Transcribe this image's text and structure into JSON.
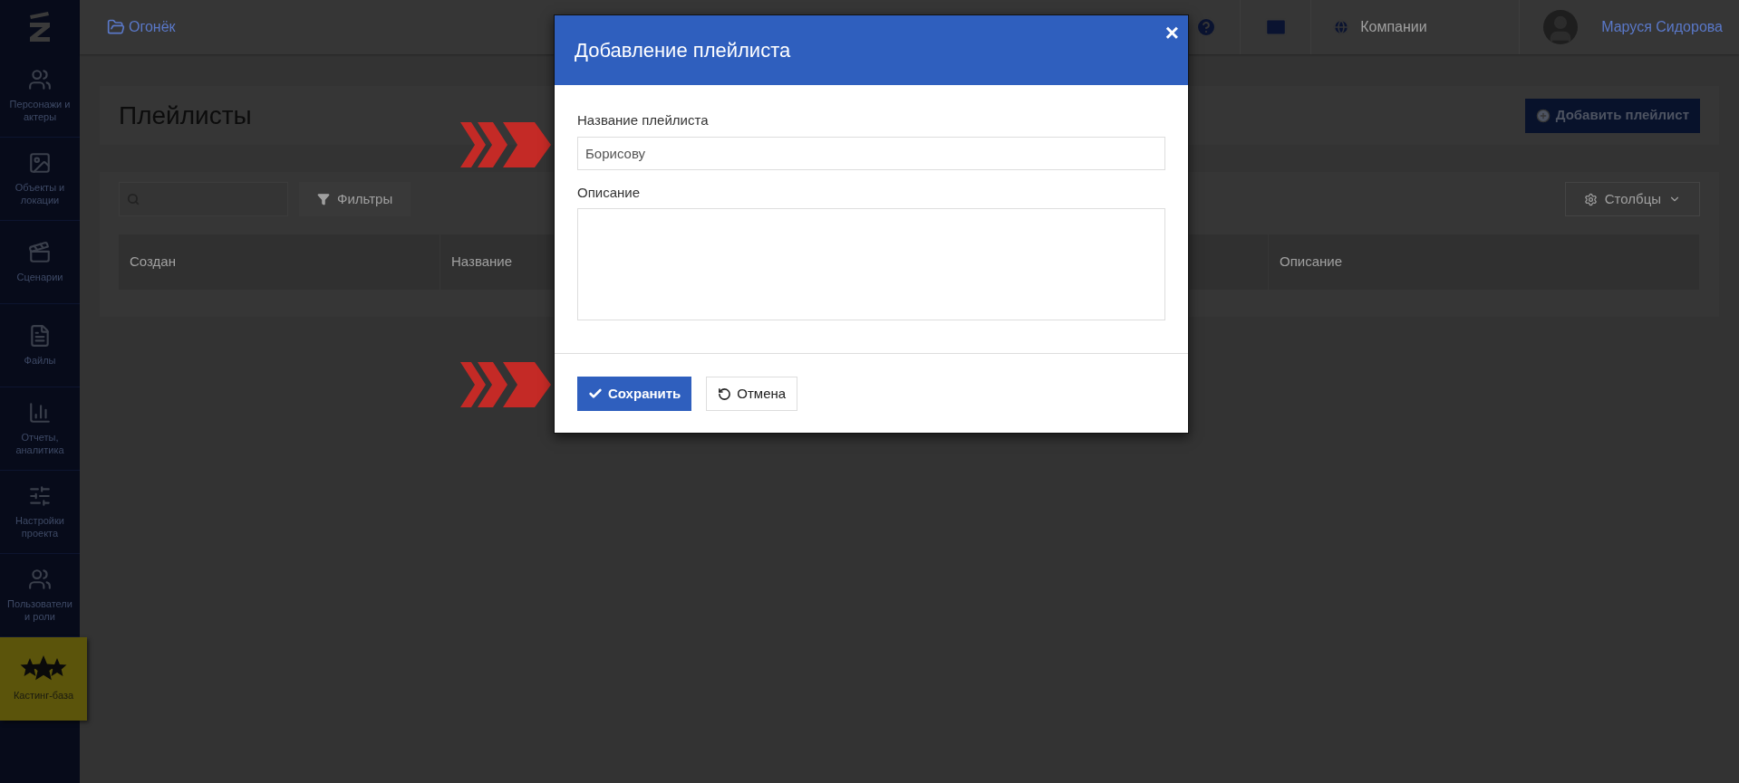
{
  "sidebar": {
    "items": [
      {
        "label": "Персонажи и актеры",
        "selected": false
      },
      {
        "label": "Объекты и локации",
        "selected": false
      },
      {
        "label": "Сценарии",
        "selected": false
      },
      {
        "label": "Файлы",
        "selected": false
      },
      {
        "label": "Отчеты, аналитика",
        "selected": false
      },
      {
        "label": "Настройки проекта",
        "selected": false
      },
      {
        "label": "Пользователи и роли",
        "selected": false
      },
      {
        "label": "Кастинг-база",
        "selected": true
      }
    ]
  },
  "topbar": {
    "breadcrumb": "Огонёк",
    "company_link": "Компании",
    "user_name": "Маруся Сидорова"
  },
  "page": {
    "title": "Плейлисты",
    "add_button": "Добавить плейлист",
    "filters_button": "Фильтры",
    "columns_button": "Столбцы",
    "table": {
      "columns": [
        "Создан",
        "Название",
        "Описание"
      ]
    }
  },
  "modal": {
    "title": "Добавление плейлиста",
    "close": "×",
    "fields": [
      {
        "kind": "input",
        "label": "Название плейлиста",
        "value": "Борисову"
      },
      {
        "kind": "textarea",
        "label": "Описание"
      }
    ],
    "buttons": [
      {
        "kind": "primary",
        "label": "Сохранить"
      },
      {
        "kind": "secondary",
        "label": "Отмена"
      }
    ]
  }
}
